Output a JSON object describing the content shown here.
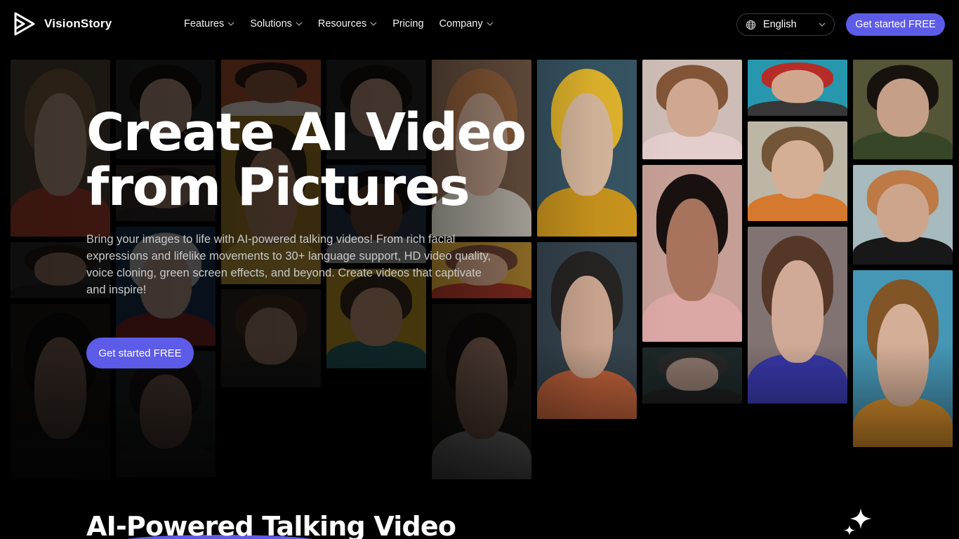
{
  "brand": {
    "name": "VisionStory",
    "logo_icon": "play-logo-icon"
  },
  "nav": {
    "items": [
      {
        "label": "Features",
        "has_dropdown": true
      },
      {
        "label": "Solutions",
        "has_dropdown": true
      },
      {
        "label": "Resources",
        "has_dropdown": true
      },
      {
        "label": "Pricing",
        "has_dropdown": false
      },
      {
        "label": "Company",
        "has_dropdown": true
      }
    ],
    "language": {
      "label": "English",
      "icon": "globe-icon"
    },
    "cta": "Get started FREE"
  },
  "hero": {
    "title_line1": "Create AI Video",
    "title_line2": "from Pictures",
    "subtitle": "Bring your images to life with AI-powered talking videos! From rich facial expressions and lifelike movements to 30+ language support, HD video quality, voice cloning, green screen effects, and beyond. Create videos that captivate and inspire!",
    "cta": "Get started FREE"
  },
  "section2": {
    "title": "AI-Powered Talking Video",
    "icon": "sparkle-icon"
  },
  "colors": {
    "accent": "#5d5ce8",
    "background": "#000000",
    "subtitle": "#c9c9c9"
  }
}
